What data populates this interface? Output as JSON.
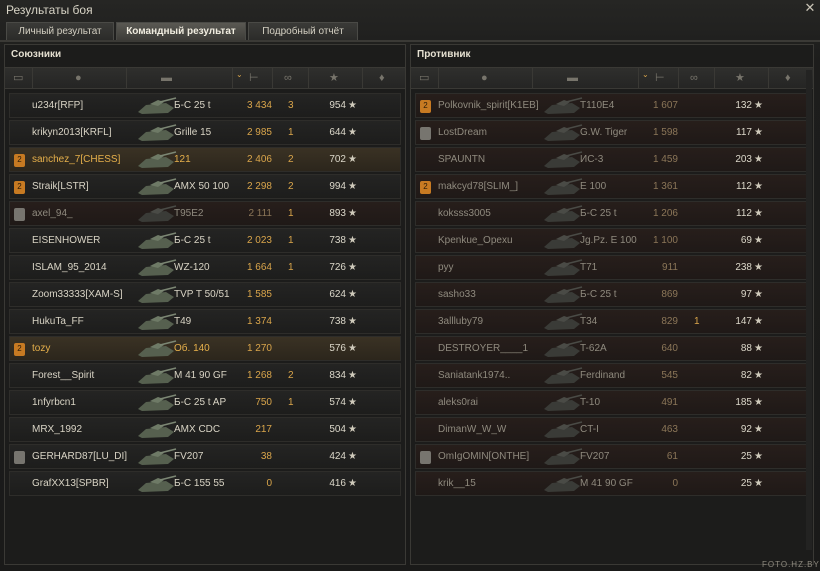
{
  "window": {
    "title": "Результаты боя",
    "close_icon": "close-icon"
  },
  "tabs": [
    {
      "label": "Личный результат",
      "active": false
    },
    {
      "label": "Командный результат",
      "active": true
    },
    {
      "label": "Подробный отчёт",
      "active": false
    }
  ],
  "allies": {
    "title": "Союзники",
    "rows": [
      {
        "badge": "",
        "player": "u234r[RFP]",
        "vehicle": "Б-С 25 t",
        "damage": "3 434",
        "kills": "3",
        "xp": "954",
        "state": "normal"
      },
      {
        "badge": "",
        "player": "krikyn2013[KRFL]",
        "vehicle": "Grille 15",
        "damage": "2 985",
        "kills": "1",
        "xp": "644",
        "state": "normal"
      },
      {
        "badge": "2",
        "player": "sanchez_7[CHESS]",
        "vehicle": "121",
        "damage": "2 406",
        "kills": "2",
        "xp": "702",
        "state": "hl"
      },
      {
        "badge": "2",
        "player": "Straik[LSTR]",
        "vehicle": "AMX 50 100",
        "damage": "2 298",
        "kills": "2",
        "xp": "994",
        "state": "normal"
      },
      {
        "badge": "div",
        "player": "axel_94_",
        "vehicle": "T95E2",
        "damage": "2 111",
        "kills": "1",
        "xp": "893",
        "state": "dead"
      },
      {
        "badge": "",
        "player": "EISENHOWER",
        "vehicle": "Б-С 25 t",
        "damage": "2 023",
        "kills": "1",
        "xp": "738",
        "state": "normal"
      },
      {
        "badge": "",
        "player": "ISLAM_95_2014",
        "vehicle": "WZ-120",
        "damage": "1 664",
        "kills": "1",
        "xp": "726",
        "state": "normal"
      },
      {
        "badge": "",
        "player": "Zoom33333[XAM-S]",
        "vehicle": "TVP T 50/51",
        "damage": "1 585",
        "kills": "",
        "xp": "624",
        "state": "normal"
      },
      {
        "badge": "",
        "player": "HukuTa_FF",
        "vehicle": "T49",
        "damage": "1 374",
        "kills": "",
        "xp": "738",
        "state": "normal"
      },
      {
        "badge": "2",
        "player": "tozy",
        "vehicle": "Об. 140",
        "damage": "1 270",
        "kills": "",
        "xp": "576",
        "state": "hl"
      },
      {
        "badge": "",
        "player": "Forest__Spirit",
        "vehicle": "M 41 90 GF",
        "damage": "1 268",
        "kills": "2",
        "xp": "834",
        "state": "normal"
      },
      {
        "badge": "",
        "player": "1nfyrbcn1",
        "vehicle": "Б-С 25 t AP",
        "damage": "750",
        "kills": "1",
        "xp": "574",
        "state": "normal"
      },
      {
        "badge": "",
        "player": "MRX_1992",
        "vehicle": "AMX CDC",
        "damage": "217",
        "kills": "",
        "xp": "504",
        "state": "normal"
      },
      {
        "badge": "div",
        "player": "GERHARD87[LU_DI]",
        "vehicle": "FV207",
        "damage": "38",
        "kills": "",
        "xp": "424",
        "state": "normal"
      },
      {
        "badge": "",
        "player": "GrafXX13[SPBR]",
        "vehicle": "Б-С 155 55",
        "damage": "0",
        "kills": "",
        "xp": "416",
        "state": "normal"
      }
    ]
  },
  "enemies": {
    "title": "Противник",
    "rows": [
      {
        "badge": "2",
        "player": "Polkovnik_spirit[K1EB]",
        "vehicle": "T110E4",
        "damage": "1 607",
        "kills": "",
        "xp": "132",
        "state": "dead"
      },
      {
        "badge": "div",
        "player": "LostDream",
        "vehicle": "G.W. Tiger",
        "damage": "1 598",
        "kills": "",
        "xp": "117",
        "state": "dead"
      },
      {
        "badge": "",
        "player": "SPAUNTN",
        "vehicle": "ИС-3",
        "damage": "1 459",
        "kills": "",
        "xp": "203",
        "state": "dead"
      },
      {
        "badge": "2",
        "player": "makcyd78[SLIM_]",
        "vehicle": "E 100",
        "damage": "1 361",
        "kills": "",
        "xp": "112",
        "state": "dead"
      },
      {
        "badge": "",
        "player": "koksss3005",
        "vehicle": "Б-С 25 t",
        "damage": "1 206",
        "kills": "",
        "xp": "112",
        "state": "dead"
      },
      {
        "badge": "",
        "player": "Kpenkue_Opexu",
        "vehicle": "Jg.Pz. E 100",
        "damage": "1 100",
        "kills": "",
        "xp": "69",
        "state": "dead"
      },
      {
        "badge": "",
        "player": "pyy",
        "vehicle": "T71",
        "damage": "911",
        "kills": "",
        "xp": "238",
        "state": "dead"
      },
      {
        "badge": "",
        "player": "sasho33",
        "vehicle": "Б-С 25 t",
        "damage": "869",
        "kills": "",
        "xp": "97",
        "state": "dead"
      },
      {
        "badge": "",
        "player": "3allluby79",
        "vehicle": "T34",
        "damage": "829",
        "kills": "1",
        "xp": "147",
        "state": "dead"
      },
      {
        "badge": "",
        "player": "DESTROYER____1",
        "vehicle": "T-62A",
        "damage": "640",
        "kills": "",
        "xp": "88",
        "state": "dead"
      },
      {
        "badge": "",
        "player": "Saniatank1974..",
        "vehicle": "Ferdinand",
        "damage": "545",
        "kills": "",
        "xp": "82",
        "state": "dead"
      },
      {
        "badge": "",
        "player": "aleks0rai",
        "vehicle": "T-10",
        "damage": "491",
        "kills": "",
        "xp": "185",
        "state": "dead"
      },
      {
        "badge": "",
        "player": "DimanW_W_W",
        "vehicle": "CT-I",
        "damage": "463",
        "kills": "",
        "xp": "92",
        "state": "dead"
      },
      {
        "badge": "div",
        "player": "OmIgOMIN[ONTHE]",
        "vehicle": "FV207",
        "damage": "61",
        "kills": "",
        "xp": "25",
        "state": "dead"
      },
      {
        "badge": "",
        "player": "krik__15",
        "vehicle": "M 41 90 GF",
        "damage": "0",
        "kills": "",
        "xp": "25",
        "state": "dead"
      }
    ]
  },
  "header_icons": [
    "platoon-icon",
    "player-icon",
    "vehicle-icon",
    "damage-icon",
    "kills-icon",
    "xp-icon",
    "medal-icon"
  ],
  "watermark": "FOTO.HZ.BY"
}
